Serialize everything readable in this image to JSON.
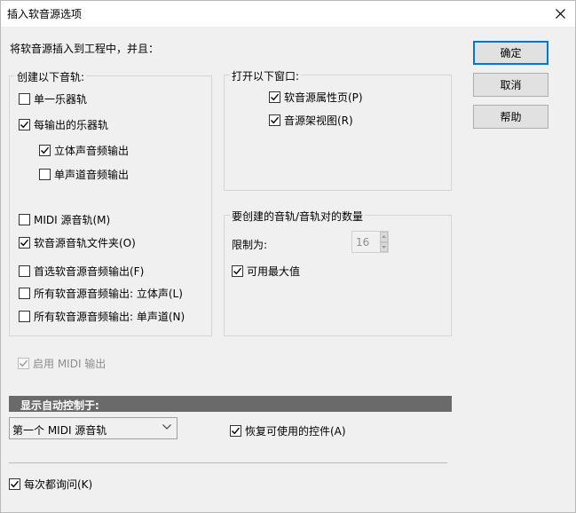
{
  "dialog": {
    "title": "插入软音源选项"
  },
  "intro": "将软音源插入到工程中，并且：",
  "create_tracks": {
    "legend": "创建以下音轨:",
    "single_instrument": {
      "label": "单一乐器轨",
      "checked": false
    },
    "per_output_instrument": {
      "label": "每输出的乐器轨",
      "checked": true
    },
    "stereo_audio_output": {
      "label": "立体声音频输出",
      "checked": true
    },
    "mono_audio_output": {
      "label": "单声道音频输出",
      "checked": false
    },
    "midi_source_track": {
      "label": "MIDI 源音轨(M)",
      "checked": false
    },
    "synth_track_folder": {
      "label": "软音源音轨文件夹(O)",
      "checked": true
    },
    "first_synth_audio_output": {
      "label": "首选软音源音频输出(F)",
      "checked": false
    },
    "all_synth_audio_stereo": {
      "label": "所有软音源音频输出: 立体声(L)",
      "checked": false
    },
    "all_synth_audio_mono": {
      "label": "所有软音源音频输出: 单声道(N)",
      "checked": false
    }
  },
  "open_windows": {
    "legend": "打开以下窗口:",
    "synth_property_page": {
      "label": "软音源属性页(P)",
      "checked": true
    },
    "synth_rack_view": {
      "label": "音源架视图(R)",
      "checked": true
    }
  },
  "track_count": {
    "legend": "要创建的音轨/音轨对的数量",
    "limit_label": "限制为:",
    "limit_value": "16",
    "max_available": {
      "label": "可用最大值",
      "checked": true
    }
  },
  "enable_midi_output": {
    "label": "启用 MIDI 输出",
    "checked": true,
    "disabled": true
  },
  "auto_control": {
    "header": "显示自动控制于:",
    "selected": "第一个 MIDI 源音轨",
    "restore_controls": {
      "label": "恢复可使用的控件(A)",
      "checked": true
    }
  },
  "ask_every_time": {
    "label": "每次都询问(K)",
    "checked": true
  },
  "buttons": {
    "ok": "确定",
    "cancel": "取消",
    "help": "帮助"
  }
}
